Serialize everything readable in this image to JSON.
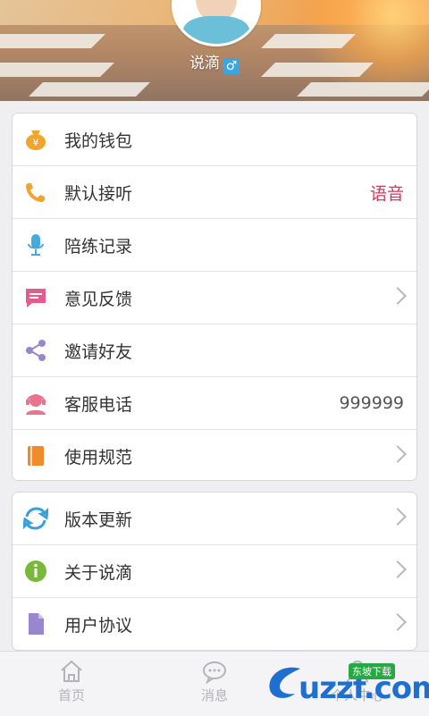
{
  "profile": {
    "username": "说滴",
    "gender_symbol": "♂"
  },
  "menu_group_1": [
    {
      "label": "我的钱包",
      "icon": "wallet-icon",
      "color": "#f2a42c"
    },
    {
      "label": "默认接听",
      "icon": "phone-icon",
      "color": "#f2a42c",
      "value": "语音"
    },
    {
      "label": "陪练记录",
      "icon": "microphone-icon",
      "color": "#45a9de"
    },
    {
      "label": "意见反馈",
      "icon": "message-icon",
      "color": "#e45b8f"
    },
    {
      "label": "邀请好友",
      "icon": "share-icon",
      "color": "#9a86cf"
    },
    {
      "label": "客服电话",
      "icon": "customer-service-icon",
      "color": "#e9748d",
      "value": "999999"
    },
    {
      "label": "使用规范",
      "icon": "book-icon",
      "color": "#ef8b2a"
    }
  ],
  "menu_group_2": [
    {
      "label": "版本更新",
      "icon": "refresh-icon",
      "color": "#3aa0dd"
    },
    {
      "label": "关于说滴",
      "icon": "info-icon",
      "color": "#7ab83b"
    },
    {
      "label": "用户协议",
      "icon": "document-icon",
      "color": "#9a86cf"
    }
  ],
  "tabs": [
    {
      "label": "首页",
      "icon": "home-icon"
    },
    {
      "label": "消息",
      "icon": "chat-icon"
    },
    {
      "label": "个人中心",
      "icon": "person-icon"
    }
  ],
  "watermark": {
    "text": "uzzf.com",
    "badge": "东坡下载"
  },
  "colors": {
    "accent_red": "#d3385c",
    "tab_inactive": "#b4b4b8"
  }
}
